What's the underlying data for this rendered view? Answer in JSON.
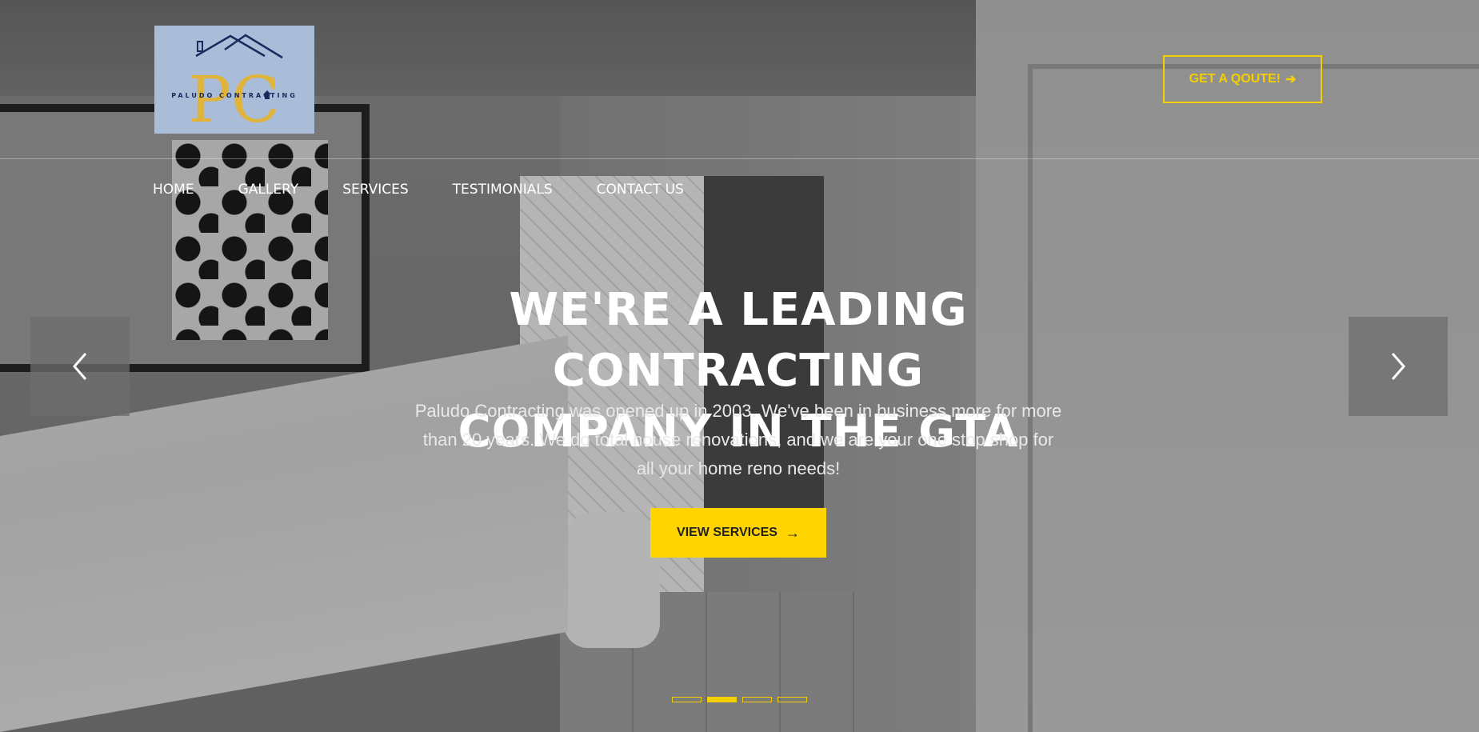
{
  "header": {
    "logo": {
      "initials": "PC",
      "wordmark": "PALUDO CONTRACTING",
      "colors": {
        "background": "#a9bcd8",
        "initials": "#e0b43a",
        "roof": "#1b2a5c"
      }
    },
    "quote_button": {
      "label": "GET A QOUTE!",
      "icon": "arrow-right-icon"
    },
    "nav": {
      "items": [
        {
          "label": "HOME"
        },
        {
          "label": "GALLERY"
        },
        {
          "label": "SERVICES"
        },
        {
          "label": "TESTIMONIALS"
        },
        {
          "label": "CONTACT US"
        }
      ]
    }
  },
  "hero": {
    "title_line1": "WE'RE A LEADING CONTRACTING",
    "title_line2": "COMPANY IN THE GTA",
    "description": "Paludo Contracting was opened up in 2003. We've been in business more for more than 20 years. We do total house renovations, and we are your one stop shop for all your home reno needs!",
    "cta": {
      "label": "VIEW SERVICES",
      "icon": "arrow-right-icon"
    },
    "slider": {
      "prev_icon": "chevron-left-icon",
      "next_icon": "chevron-right-icon",
      "slide_count": 4,
      "active_index": 1
    }
  },
  "colors": {
    "accent": "#ffd400",
    "text": "#ffffff"
  }
}
